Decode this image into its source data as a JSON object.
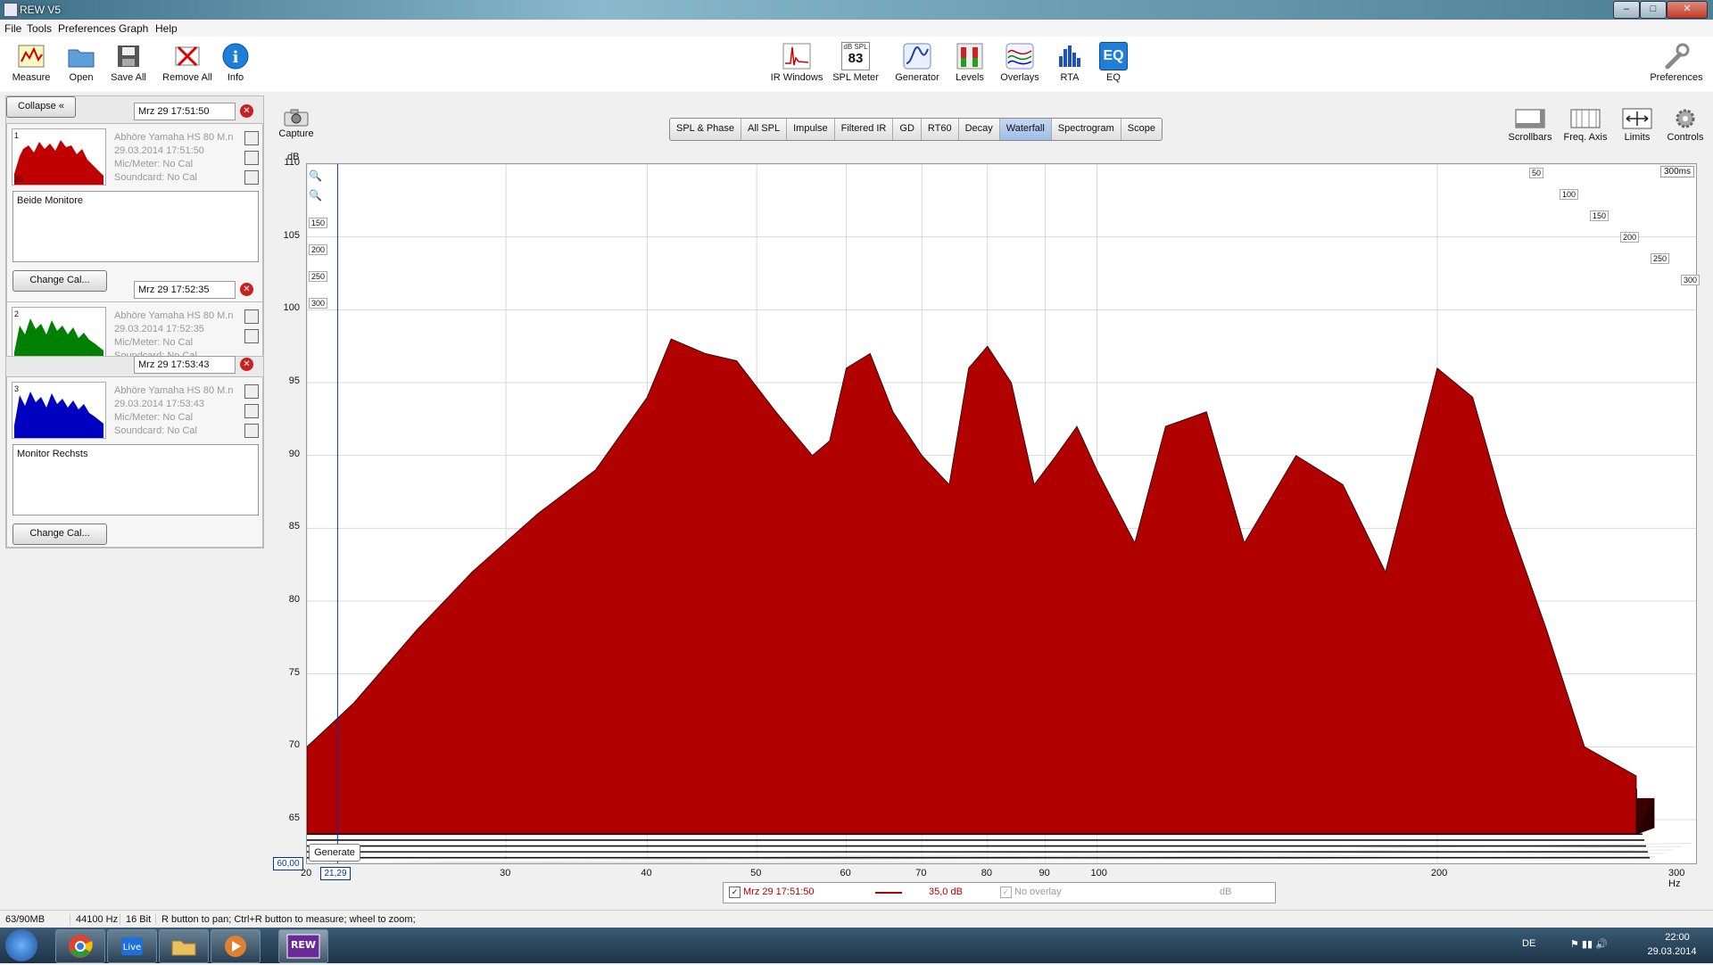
{
  "window": {
    "title": "REW V5"
  },
  "menu": [
    "File",
    "Tools",
    "Preferences",
    "Graph",
    "Help"
  ],
  "toolbar": {
    "left": [
      {
        "label": "Measure",
        "icon": "measure-icon"
      },
      {
        "label": "Open",
        "icon": "folder-icon"
      },
      {
        "label": "Save All",
        "icon": "save-icon"
      },
      {
        "label": "Remove All",
        "icon": "remove-icon"
      },
      {
        "label": "Info",
        "icon": "info-icon"
      }
    ],
    "center": [
      {
        "label": "IR Windows",
        "icon": "ir-windows-icon"
      },
      {
        "label": "SPL Meter",
        "icon": "spl-meter-icon",
        "badge_top": "dB SPL",
        "badge_value": "83"
      },
      {
        "label": "Generator",
        "icon": "generator-icon"
      },
      {
        "label": "Levels",
        "icon": "levels-icon"
      },
      {
        "label": "Overlays",
        "icon": "overlays-icon"
      },
      {
        "label": "RTA",
        "icon": "rta-icon"
      },
      {
        "label": "EQ",
        "icon": "eq-icon",
        "badge_value": "EQ"
      }
    ],
    "right": [
      {
        "label": "Preferences",
        "icon": "wrench-icon"
      }
    ]
  },
  "capture": {
    "label": "Capture"
  },
  "graph_tabs": [
    "SPL & Phase",
    "All SPL",
    "Impulse",
    "Filtered IR",
    "GD",
    "RT60",
    "Decay",
    "Waterfall",
    "Spectrogram",
    "Scope"
  ],
  "graph_tab_active": "Waterfall",
  "graph_controls": [
    {
      "label": "Scrollbars",
      "icon": "scrollbars-icon"
    },
    {
      "label": "Freq. Axis",
      "icon": "freq-axis-icon"
    },
    {
      "label": "Limits",
      "icon": "limits-icon"
    },
    {
      "label": "Controls",
      "icon": "controls-icon"
    }
  ],
  "panel": {
    "collapse_label": "Collapse",
    "change_cal_label": "Change Cal..."
  },
  "measurements": [
    {
      "index": "1",
      "date": "Mrz 29 17:51:50",
      "name": "Abhöre Yamaha HS 80 M.n",
      "datetime": "29.03.2014 17:51:50",
      "mic": "Mic/Meter: No Cal",
      "soundcard": "Soundcard: No Cal",
      "notes": "Beide Monitore",
      "color": "#c00000"
    },
    {
      "index": "2",
      "date": "Mrz 29 17:52:35",
      "name": "Abhöre Yamaha HS 80 M.n",
      "datetime": "29.03.2014 17:52:35",
      "mic": "Mic/Meter: No Cal",
      "soundcard": "Soundcard: No Cal",
      "notes": "",
      "color": "#008000"
    },
    {
      "index": "3",
      "date": "Mrz 29 17:53:43",
      "name": "Abhöre Yamaha HS 80 M.n",
      "datetime": "29.03.2014 17:53:43",
      "mic": "Mic/Meter: No Cal",
      "soundcard": "Soundcard: No Cal",
      "notes": "Monitor Rechsts",
      "color": "#0000c0"
    }
  ],
  "thumb_axis_label": "20",
  "plot": {
    "yunit": "dB",
    "generate_label": "Generate",
    "y_readout": "60,00",
    "x_readout": "21,29",
    "depth_labels": [
      "50",
      "100",
      "150",
      "200",
      "250",
      "300"
    ],
    "depth_end": "300ms",
    "x_end_label": "300 Hz"
  },
  "chart_data": {
    "type": "area",
    "subtype": "waterfall",
    "x_scale": "log",
    "xlim": [
      20,
      300
    ],
    "ylim": [
      62,
      110
    ],
    "y_ticks": [
      65,
      70,
      75,
      80,
      85,
      90,
      95,
      100,
      105,
      110
    ],
    "x_ticks": [
      20,
      30,
      40,
      50,
      60,
      70,
      80,
      90,
      100,
      200
    ],
    "time_slices_ms": [
      0,
      50,
      100,
      150,
      200,
      250,
      300
    ],
    "front_slice_db": [
      [
        20,
        70
      ],
      [
        22,
        73
      ],
      [
        25,
        78
      ],
      [
        28,
        82
      ],
      [
        32,
        86
      ],
      [
        36,
        89
      ],
      [
        40,
        94
      ],
      [
        42,
        98
      ],
      [
        45,
        97
      ],
      [
        48,
        96.5
      ],
      [
        52,
        93
      ],
      [
        56,
        90
      ],
      [
        58,
        91
      ],
      [
        60,
        96
      ],
      [
        63,
        97
      ],
      [
        66,
        93
      ],
      [
        70,
        90
      ],
      [
        74,
        88
      ],
      [
        77,
        96
      ],
      [
        80,
        97.5
      ],
      [
        84,
        95
      ],
      [
        88,
        88
      ],
      [
        92,
        90
      ],
      [
        96,
        92
      ],
      [
        100,
        89
      ],
      [
        108,
        84
      ],
      [
        115,
        92
      ],
      [
        125,
        93
      ],
      [
        135,
        84
      ],
      [
        150,
        90
      ],
      [
        165,
        88
      ],
      [
        180,
        82
      ],
      [
        200,
        96
      ],
      [
        215,
        94
      ],
      [
        230,
        86
      ],
      [
        250,
        78
      ],
      [
        270,
        70
      ],
      [
        300,
        68
      ]
    ],
    "series_color": "#b00000"
  },
  "legend": {
    "name": "Mrz 29 17:51:50",
    "value": "35,0 dB",
    "overlay": "No overlay",
    "unit": "dB"
  },
  "status": [
    "63/90MB",
    "44100 Hz",
    "16 Bit",
    "R button to pan; Ctrl+R button to measure; wheel to zoom;"
  ],
  "tray": {
    "lang": "DE",
    "time": "22:00",
    "date": "29.03.2014"
  }
}
